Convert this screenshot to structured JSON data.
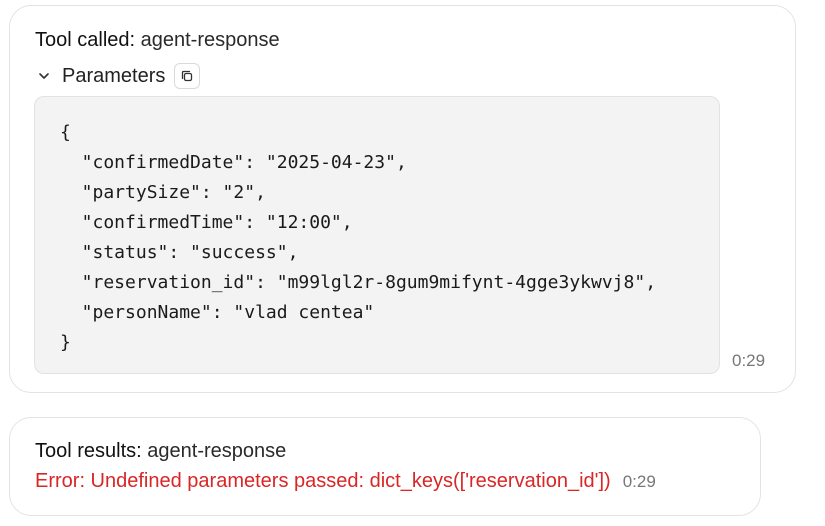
{
  "tool_call": {
    "title_prefix": "Tool called:",
    "tool_name": "agent-response",
    "params_label": "Parameters",
    "code_lines": [
      "{",
      "  \"confirmedDate\": \"2025-04-23\",",
      "  \"partySize\": \"2\",",
      "  \"confirmedTime\": \"12:00\",",
      "  \"status\": \"success\",",
      "  \"reservation_id\": \"m99lgl2r-8gum9mifynt-4gge3ykwvj8\",",
      "  \"personName\": \"vlad centea\"",
      "}"
    ],
    "timestamp": "0:29",
    "icons": {
      "expand": "chevron-down-icon",
      "copy": "copy-icon"
    }
  },
  "tool_result": {
    "title_prefix": "Tool results:",
    "tool_name": "agent-response",
    "error_message": "Error: Undefined parameters passed: dict_keys(['reservation_id'])",
    "timestamp": "0:29"
  },
  "colors": {
    "error": "#d92626",
    "timestamp": "#777777",
    "code_background": "#f3f3f3",
    "card_border": "#e3e3e3"
  }
}
